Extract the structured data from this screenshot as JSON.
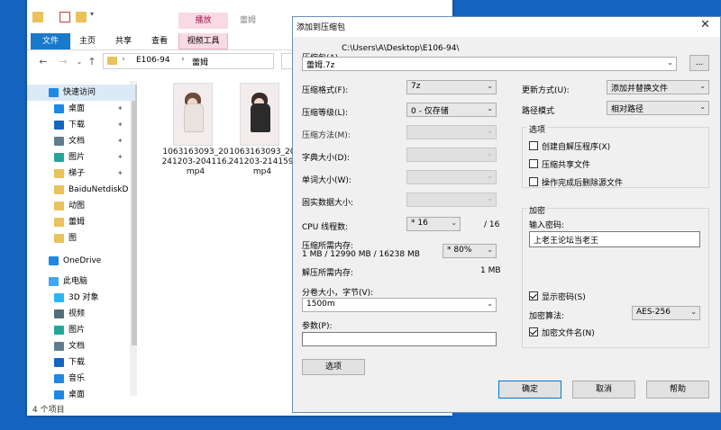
{
  "explorer": {
    "ribbon_context_header": "播放",
    "title_folder": "蕾姆",
    "tabs": [
      "文件",
      "主页",
      "共享",
      "查看",
      "视频工具"
    ],
    "address": {
      "segment1": "E106-94",
      "segment2": "蕾姆"
    },
    "sidebar": [
      {
        "label": "快速访问",
        "icon": "star-icon",
        "color": "#1e88e5",
        "pinned": false
      },
      {
        "label": "桌面",
        "icon": "desktop-icon",
        "color": "#1e88e5",
        "pinned": true
      },
      {
        "label": "下载",
        "icon": "download-icon",
        "color": "#1565c0",
        "pinned": true
      },
      {
        "label": "文档",
        "icon": "documents-icon",
        "color": "#607d8b",
        "pinned": true
      },
      {
        "label": "图片",
        "icon": "pictures-icon",
        "color": "#26a69a",
        "pinned": true
      },
      {
        "label": "梯子",
        "icon": "folder-icon",
        "color": "#e8c25a",
        "pinned": true
      },
      {
        "label": "BaiduNetdiskD",
        "icon": "folder-icon",
        "color": "#e8c25a",
        "pinned": false
      },
      {
        "label": "动图",
        "icon": "folder-icon",
        "color": "#e8c25a",
        "pinned": false
      },
      {
        "label": "蕾姆",
        "icon": "folder-icon",
        "color": "#e8c25a",
        "pinned": false
      },
      {
        "label": "图",
        "icon": "folder-icon",
        "color": "#e8c25a",
        "pinned": false
      },
      {
        "label": "OneDrive",
        "icon": "cloud-icon",
        "color": "#1e88e5",
        "pinned": false
      },
      {
        "label": "此电脑",
        "icon": "computer-icon",
        "color": "#42a5f5",
        "pinned": false
      },
      {
        "label": "3D 对象",
        "icon": "cube-icon",
        "color": "#29b6f6",
        "pinned": false
      },
      {
        "label": "视频",
        "icon": "video-icon",
        "color": "#546e7a",
        "pinned": false
      },
      {
        "label": "图片",
        "icon": "pictures-icon",
        "color": "#26a69a",
        "pinned": false
      },
      {
        "label": "文档",
        "icon": "documents-icon",
        "color": "#607d8b",
        "pinned": false
      },
      {
        "label": "下载",
        "icon": "download-icon",
        "color": "#1565c0",
        "pinned": false
      },
      {
        "label": "音乐",
        "icon": "music-icon",
        "color": "#1e88e5",
        "pinned": false
      },
      {
        "label": "桌面",
        "icon": "desktop-icon",
        "color": "#1e88e5",
        "pinned": false
      }
    ],
    "files": [
      {
        "name": "1063163093_20241203-204116.mp4"
      },
      {
        "name": "1063163093_20241203-214159.mp4"
      }
    ],
    "status": "4 个项目"
  },
  "dialog": {
    "title": "添加到压缩包",
    "archive_label": "压缩包(A)",
    "archive_path": "C:\\Users\\A\\Desktop\\E106-94\\",
    "archive_name": "蕾姆.7z",
    "browse_label": "...",
    "format_label": "压缩格式(F):",
    "format_value": "7z",
    "level_label": "压缩等级(L):",
    "level_value": "0 - 仅存储",
    "method_label": "压缩方法(M):",
    "dict_label": "字典大小(D):",
    "word_label": "单词大小(W):",
    "solid_label": "固实数据大小:",
    "threads_label": "CPU 线程数:",
    "threads_value": "* 16",
    "threads_total": "/ 16",
    "mem_label": "压缩所需内存:",
    "mem_value": "1 MB / 12990 MB / 16238 MB",
    "mem_percent": "* 80%",
    "decomp_label": "解压所需内存:",
    "decomp_value": "1 MB",
    "split_label": "分卷大小，字节(V):",
    "split_value": "1500m",
    "params_label": "参数(P):",
    "params_value": "",
    "options_button": "选项",
    "update_label": "更新方式(U):",
    "update_value": "添加并替换文件",
    "path_label": "路径模式",
    "path_value": "相对路径",
    "options_group": "选项",
    "opt_sfx": "创建自解压程序(X)",
    "opt_shared": "压缩共享文件",
    "opt_delete": "操作完成后删除源文件",
    "encrypt_group": "加密",
    "password_label": "输入密码:",
    "password_value": "上老王论坛当老王",
    "show_password": "显示密码(S)",
    "enc_method_label": "加密算法:",
    "enc_method_value": "AES-256",
    "encrypt_names": "加密文件名(N)",
    "ok": "确定",
    "cancel": "取消",
    "help": "帮助"
  }
}
